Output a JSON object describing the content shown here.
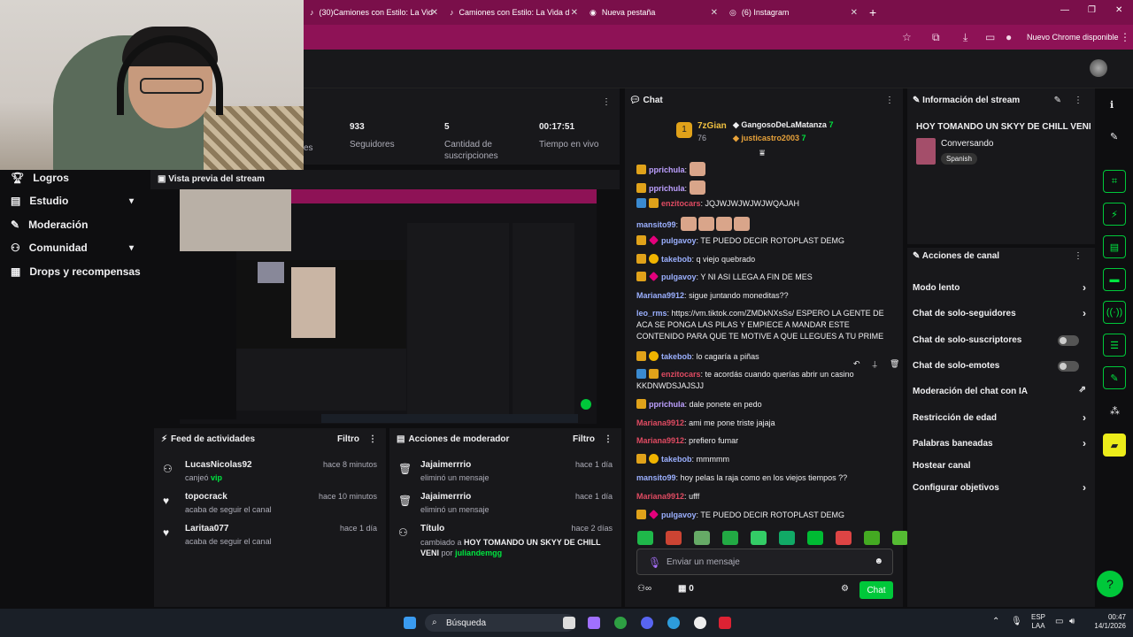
{
  "browser": {
    "tabs": [
      {
        "label": "(30)Camiones con Estilo: La Vid"
      },
      {
        "label": "Camiones con Estilo: La Vida d"
      },
      {
        "label": "Nueva pestaña"
      },
      {
        "label": "(6) Instagram"
      }
    ],
    "chrome_pill": "Nuevo Chrome disponible"
  },
  "sidebar": {
    "items": [
      {
        "label": "Logros",
        "icon": "trophy-icon"
      },
      {
        "label": "Estudio",
        "icon": "film-icon"
      },
      {
        "label": "Moderación",
        "icon": "wrench-icon"
      },
      {
        "label": "Comunidad",
        "icon": "people-icon"
      },
      {
        "label": "Drops y recompensas",
        "icon": "gift-icon"
      }
    ]
  },
  "stats": [
    {
      "value": "933",
      "label": "Seguidores"
    },
    {
      "value": "5",
      "label": "Cantidad de suscripciones"
    },
    {
      "value": "00:17:51",
      "label": "Tiempo en vivo"
    }
  ],
  "stats_partial_label": "es",
  "preview": {
    "title": "Vista previa del stream"
  },
  "feed": {
    "title": "Feed de actividades",
    "filter": "Filtro",
    "items": [
      {
        "name": "LucasNicolas92",
        "sub": "canjeó",
        "sub_accent": "vip",
        "time": "hace 8 minutos"
      },
      {
        "name": "topocrack",
        "sub": "acaba de seguir el canal",
        "time": "hace 10 minutos"
      },
      {
        "name": "Laritaa077",
        "sub": "acaba de seguir el canal",
        "time": "hace 1 día"
      }
    ]
  },
  "modactions": {
    "title": "Acciones de moderador",
    "filter": "Filtro",
    "items": [
      {
        "name": "Jajaimerrrio",
        "sub": "eliminó un mensaje",
        "time": "hace 1 día"
      },
      {
        "name": "Jajaimerrrio",
        "sub": "eliminó un mensaje",
        "time": "hace 1 día"
      },
      {
        "name": "Título",
        "sub": "cambiado a",
        "sub_bold": "HOY TOMANDO UN SKYY DE CHILL VENI",
        "sub_tail": "por",
        "sub_accent": "juliandemgg",
        "time": "hace 2 días"
      }
    ]
  },
  "chat": {
    "title": "Chat",
    "leaders": {
      "first": "7zGian",
      "first_count": "76",
      "second": "GangosoDeLaMatanza",
      "second_count": "7",
      "third": "justicastro2003",
      "third_count": "7"
    },
    "messages": [
      {
        "user": "pprichula",
        "color": "#bda0ff",
        "text": ""
      },
      {
        "user": "pprichula",
        "color": "#bda0ff",
        "text": ""
      },
      {
        "user": "enzitocars",
        "color": "#e04b62",
        "text": "JQJWJWJWJWJWQAJAH"
      },
      {
        "user": "mansito99",
        "color": "#9bb0ff",
        "text": ""
      },
      {
        "user": "pulgavoy",
        "color": "#9bb0ff",
        "text": "TE PUEDO DECIR ROTOPLAST DEMG"
      },
      {
        "user": "takebob",
        "color": "#9bb0ff",
        "text": "q viejo quebrado"
      },
      {
        "user": "pulgavoy",
        "color": "#9bb0ff",
        "text": "Y NI ASI LLEGA A FIN DE MES"
      },
      {
        "user": "Mariana9912",
        "color": "#9bb0ff",
        "text": "sigue juntando moneditas??"
      },
      {
        "user": "leo_rms",
        "color": "#9bb0ff",
        "text": "https://vm.tiktok.com/ZMDkNXsSs/ ESPERO LA GENTE DE ACA SE PONGA LAS PILAS Y EMPIECE A MANDAR ESTE CONTENIDO PARA QUE TE MOTIVE A QUE LLEGUES A TU PRIME"
      },
      {
        "user": "takebob",
        "color": "#9bb0ff",
        "text": "lo cagaría a piñas"
      },
      {
        "user": "enzitocars",
        "color": "#e04b62",
        "text": "te acordás cuando querías abrir un casino KKDNWDSJAJSJJ"
      },
      {
        "user": "pprichula",
        "color": "#bda0ff",
        "text": "dale ponete en pedo"
      },
      {
        "user": "Mariana9912",
        "color": "#e04b62",
        "text": "ami me pone triste jajaja"
      },
      {
        "user": "Mariana9912",
        "color": "#e04b62",
        "text": "prefiero fumar"
      },
      {
        "user": "takebob",
        "color": "#9bb0ff",
        "text": "mmmmm"
      },
      {
        "user": "mansito99",
        "color": "#9bb0ff",
        "text": "hoy pelas la raja como en los viejos tiempos ??"
      },
      {
        "user": "Mariana9912",
        "color": "#e04b62",
        "text": "ufff"
      },
      {
        "user": "pulgavoy",
        "color": "#9bb0ff",
        "text": "TE PUEDO DECIR ROTOPLAST DEMG"
      }
    ],
    "input_placeholder": "Enviar un mensaje",
    "points": "0",
    "send_label": "Chat"
  },
  "info": {
    "title": "Información del stream",
    "stream_title": "HOY TOMANDO UN SKYY DE CHILL VENI",
    "category": "Conversando",
    "tag": "Spanish"
  },
  "actions": {
    "title": "Acciones de canal",
    "items": [
      {
        "label": "Modo lento",
        "type": "chevron"
      },
      {
        "label": "Chat de solo-seguidores",
        "type": "chevron"
      },
      {
        "label": "Chat de solo-suscriptores",
        "type": "toggle"
      },
      {
        "label": "Chat de solo-emotes",
        "type": "toggle"
      },
      {
        "label": "Moderación del chat con IA",
        "type": "external"
      },
      {
        "label": "Restricción de edad",
        "type": "chevron"
      },
      {
        "label": "Palabras baneadas",
        "type": "chevron"
      },
      {
        "label": "Hostear canal",
        "type": "none"
      },
      {
        "label": "Configurar objetivos",
        "type": "chevron"
      }
    ]
  },
  "taskbar": {
    "search": "Búsqueda",
    "lang": "ESP",
    "lang2": "LAA",
    "time": "00:47",
    "date": "14/1/2026"
  }
}
